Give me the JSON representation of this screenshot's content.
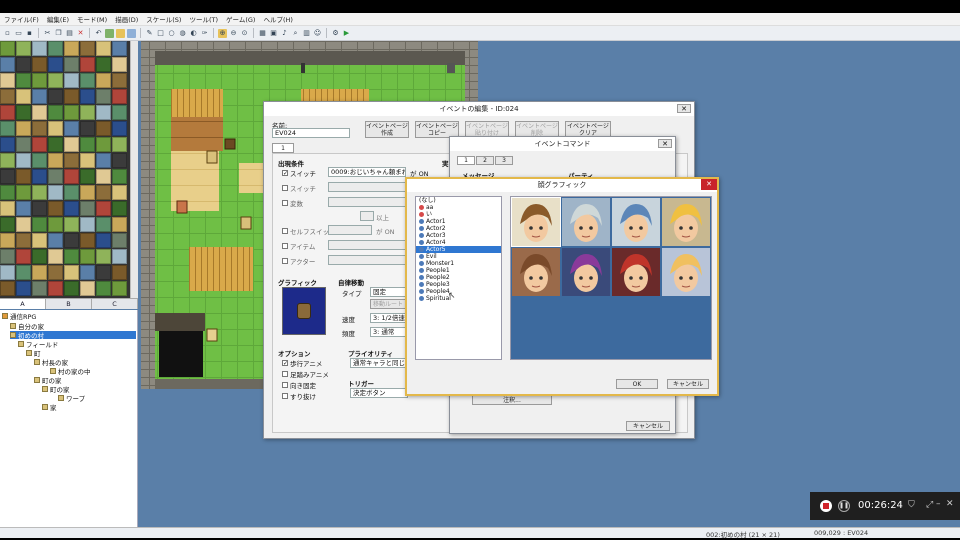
{
  "menu": [
    "ファイル(F)",
    "編集(E)",
    "モード(M)",
    "描画(D)",
    "スケール(S)",
    "ツール(T)",
    "ゲーム(G)",
    "ヘルプ(H)"
  ],
  "palette_tabs": [
    "A",
    "B",
    "C"
  ],
  "map_tree": [
    {
      "label": "通信RPG",
      "icon": "project-icon"
    },
    {
      "label": "自分の家",
      "icon": "map-icon"
    },
    {
      "label": "初めの村",
      "icon": "map-icon",
      "selected": true
    },
    {
      "label": "フィールド",
      "icon": "map-icon"
    },
    {
      "label": "町",
      "icon": "map-icon"
    },
    {
      "label": "村長の家",
      "icon": "map-icon"
    },
    {
      "label": "村の家の中",
      "icon": "map-icon"
    },
    {
      "label": "町の家",
      "icon": "map-icon"
    },
    {
      "label": "町の家",
      "icon": "map-icon"
    },
    {
      "label": "ワープ",
      "icon": "map-icon"
    },
    {
      "label": "家",
      "icon": "map-icon"
    }
  ],
  "status": {
    "map_info": "002:初めの村 (21 × 21)",
    "coords": "009,029 : EV024"
  },
  "event_editor": {
    "title": "イベントの編集 - ID:024",
    "name_label": "名前:",
    "name_value": "EV024",
    "buttons": [
      "イベントページ\n作成",
      "イベントページ\nコピー",
      "イベントページ\n貼り付け",
      "イベントページ\n削除",
      "イベントページ\nクリア"
    ],
    "page_tab": "1",
    "conditions_label": "出現条件",
    "switch_label": "スイッチ",
    "switch_value": "0009:おじいちゃん頼まれ",
    "switch_on": "が ON",
    "switch2_label": "スイッチ",
    "variable_label": "変数",
    "gte_label": "以上",
    "selfswitch_label": "セルフスイッチ",
    "selfswitch_on": "が ON",
    "item_label": "アイテム",
    "actor_label": "アクター",
    "graphic_label": "グラフィック",
    "autonomous_label": "自律移動",
    "type_label": "タイプ",
    "type_value": "固定",
    "route_btn": "移動ルート",
    "speed_label": "速度",
    "speed_value": "3: 1/2倍速",
    "freq_label": "頻度",
    "freq_value": "3: 通常",
    "options_label": "オプション",
    "opt_walk": "歩行アニメ",
    "opt_step": "足踏みアニメ",
    "opt_dirfix": "向き固定",
    "opt_through": "すり抜け",
    "priority_label": "プライオリティ",
    "priority_value": "通常キャラと同じ",
    "trigger_label": "トリガー",
    "trigger_value": "決定ボタン",
    "content_label": "実"
  },
  "event_command": {
    "title": "イベントコマンド",
    "tabs": [
      "1",
      "2",
      "3"
    ],
    "message_label": "メッセージ",
    "party_label": "パーティ",
    "script_btn": "注釈...",
    "cancel": "キャンセル"
  },
  "face_dialog": {
    "title": "顔グラフィック",
    "items": [
      "(なし)",
      "aa",
      "い",
      "Actor1",
      "Actor2",
      "Actor3",
      "Actor4",
      "Actor5",
      "Evil",
      "Monster1",
      "People1",
      "People2",
      "People3",
      "People4",
      "Spiritual"
    ],
    "selected_index": 7,
    "ok": "OK",
    "cancel": "キャンセル"
  },
  "recorder": {
    "time": "00:26:24"
  },
  "colors": {
    "accent": "#2f77d1",
    "dialog_border": "#e3b84a",
    "close_red": "#c8232b"
  }
}
